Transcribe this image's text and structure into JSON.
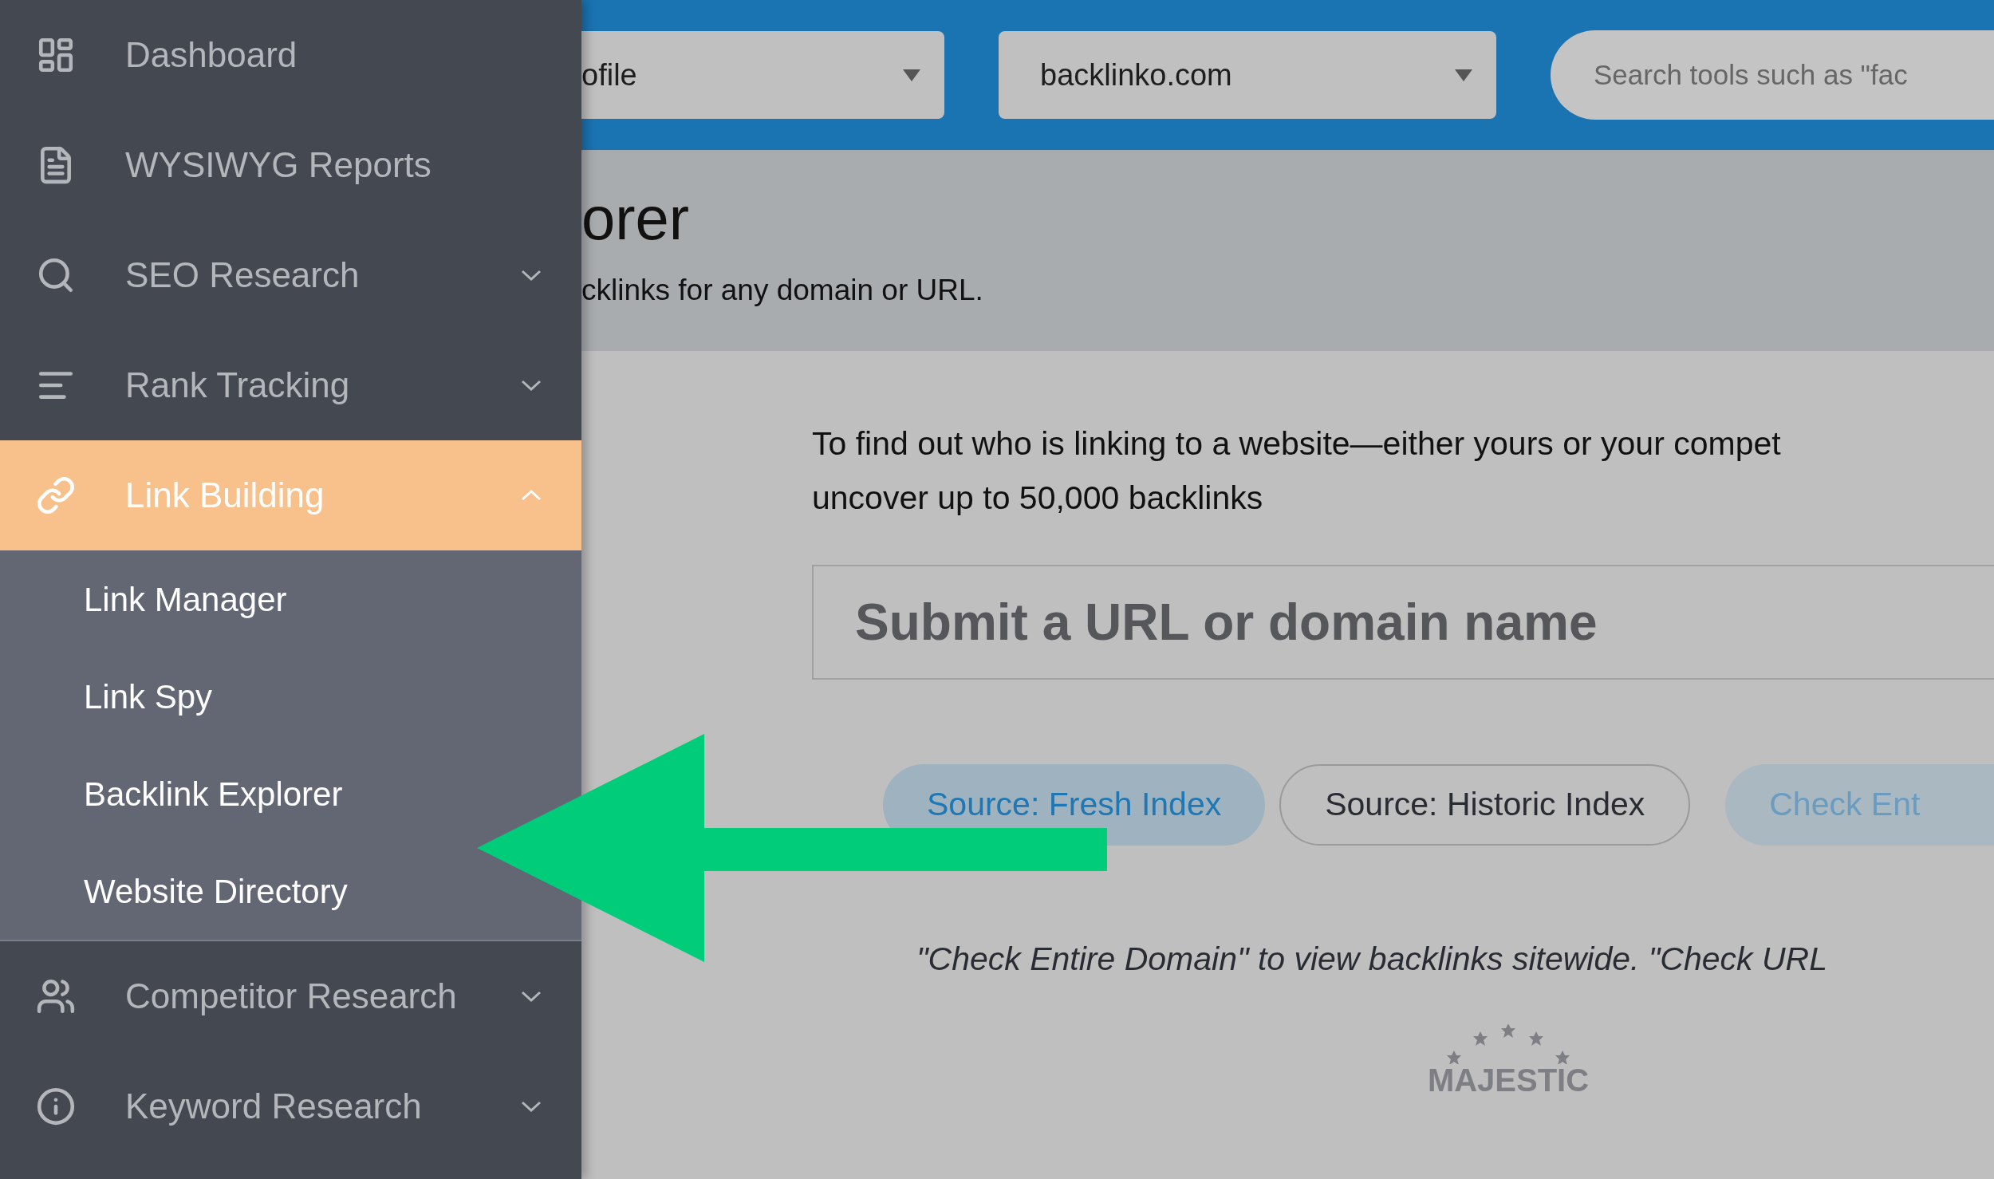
{
  "sidebar": {
    "items": [
      {
        "label": "Dashboard",
        "kind": "link",
        "selected": false
      },
      {
        "label": "WYSIWYG Reports",
        "kind": "link",
        "selected": false
      },
      {
        "label": "SEO Research",
        "kind": "group",
        "expanded": false,
        "selected": false
      },
      {
        "label": "Rank Tracking",
        "kind": "group",
        "expanded": false,
        "selected": false
      },
      {
        "label": "Link Building",
        "kind": "group",
        "expanded": true,
        "selected": true,
        "children": [
          {
            "label": "Link Manager"
          },
          {
            "label": "Link Spy"
          },
          {
            "label": "Backlink Explorer"
          },
          {
            "label": "Website Directory"
          }
        ]
      },
      {
        "label": "Competitor Research",
        "kind": "group",
        "expanded": false,
        "selected": false
      },
      {
        "label": "Keyword Research",
        "kind": "group",
        "expanded": false,
        "selected": false
      }
    ]
  },
  "top_bar": {
    "profile_dropdown": {
      "value": "ofile"
    },
    "domain_dropdown": {
      "value": "backlinko.com"
    },
    "search": {
      "placeholder": "Search tools such as \"fac"
    }
  },
  "page_header": {
    "title": "orer",
    "subtitle": "cklinks for any domain or URL."
  },
  "intro": "To find out who is linking to a website—either yours or your compet",
  "intro_line_2": "uncover up to 50,000 backlinks",
  "url_field": {
    "placeholder": "Submit a URL or domain name"
  },
  "source_buttons": [
    {
      "label": "Source: Fresh Index",
      "selected": true
    },
    {
      "label": "Source: Historic Index",
      "selected": false
    }
  ],
  "check_button": {
    "label": "Check Ent"
  },
  "hint": "\"Check Entire Domain\" to view backlinks sitewide. \"Check URL",
  "logo": {
    "text": "MAJESTIC"
  }
}
